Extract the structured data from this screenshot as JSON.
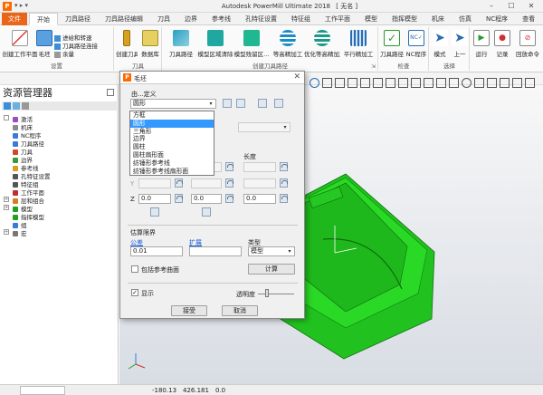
{
  "app": {
    "logo_letter": "P",
    "title": "Autodesk PowerMill Ultimate 2018",
    "title_suffix": "[ 无名 ]",
    "qat_glyphs": "▾ ▸ ▾"
  },
  "ribbon_tabs": [
    "文件",
    "开始",
    "刀具路径",
    "刀具路径编辑",
    "刀具",
    "边界",
    "参考线",
    "孔特征设置",
    "特征组",
    "工作平面",
    "模型",
    "指挥模型",
    "机床",
    "仿真",
    "NC程序",
    "查看"
  ],
  "ribbon": {
    "groups": [
      {
        "label": "设置",
        "buttons": [
          "创建工作平面",
          "毛坯"
        ],
        "small": [
          "进给和转速",
          "刀具路径连接",
          "余量"
        ]
      },
      {
        "label": "刀具",
        "buttons": [
          "创建刀具",
          "数据库"
        ]
      },
      {
        "label": "创建刀具路径",
        "buttons": [
          "刀具路径",
          "模型区域清除",
          "模型残留区...",
          "等高精加工",
          "优化等高精加工",
          "平行精加工"
        ]
      },
      {
        "label": "检查",
        "buttons": [
          "刀具路径",
          "NC程序"
        ]
      },
      {
        "label": "选择",
        "buttons": [
          "模式",
          "上一"
        ]
      },
      {
        "label": "",
        "buttons": [
          "运行",
          "记录",
          "回放命令"
        ]
      }
    ],
    "expand_glyph": "⇲"
  },
  "explorer": {
    "title": "资源管理器",
    "items": [
      {
        "label": "激活",
        "color": "#9c4dc4",
        "expand": ""
      },
      {
        "label": "机床",
        "color": "#8a8a8a",
        "expand": ""
      },
      {
        "label": "NC程序",
        "color": "#3a7bd5",
        "expand": ""
      },
      {
        "label": "刀具路径",
        "color": "#3a7bd5",
        "expand": ""
      },
      {
        "label": "刀具",
        "color": "#d04a2a",
        "expand": ""
      },
      {
        "label": "边界",
        "color": "#3a9a3a",
        "expand": ""
      },
      {
        "label": "参考线",
        "color": "#d5a020",
        "expand": ""
      },
      {
        "label": "孔特征设置",
        "color": "#555555",
        "expand": ""
      },
      {
        "label": "特征组",
        "color": "#555555",
        "expand": ""
      },
      {
        "label": "工作平面",
        "color": "#c03030",
        "expand": ""
      },
      {
        "label": "层和组合",
        "color": "#d08020",
        "expand": "+"
      },
      {
        "label": "模型",
        "color": "#20a020",
        "expand": "+"
      },
      {
        "label": "指挥模型",
        "color": "#20a020",
        "expand": ""
      },
      {
        "label": "组",
        "color": "#3a7bd5",
        "expand": ""
      },
      {
        "label": "宏",
        "color": "#777777",
        "expand": "+"
      }
    ]
  },
  "dialog": {
    "title": "毛坯",
    "close_glyph": "✕",
    "define_by_label": "由...定义",
    "define_by_value": "圆形",
    "dropdown_arrow": "▾",
    "options": [
      "方框",
      "圆形",
      "三角形",
      "边界",
      "圆柱",
      "圆柱扇形面",
      "纺锤形参考线",
      "纺锤形参考线扇形面"
    ],
    "selected_option": "圆形",
    "length_label": "长度",
    "y_label": "Y",
    "z_label": "Z",
    "z_min": "0.0",
    "z_max": "0.0",
    "z_length": "0.0",
    "estimate_label": "估算限界",
    "tolerance_label": "公差",
    "tolerance_value": "0.01",
    "extend_label": "扩展",
    "extend_value": "",
    "type_label": "类型",
    "type_value": "模型",
    "calc_button": "计算",
    "include_ref_label": "包括参考曲面",
    "include_ref_checked": false,
    "show_label": "显示",
    "show_checked": true,
    "transparency_label": "透明度",
    "accept_button": "接受",
    "cancel_button": "取消"
  },
  "statusbar": {
    "x": "-180.13",
    "y": "426.181",
    "z": "0.0"
  },
  "colors": {
    "accent": "#e8651a",
    "model_green": "#21c21f",
    "arrow_red": "#e03030",
    "selection": "#3399ff"
  }
}
